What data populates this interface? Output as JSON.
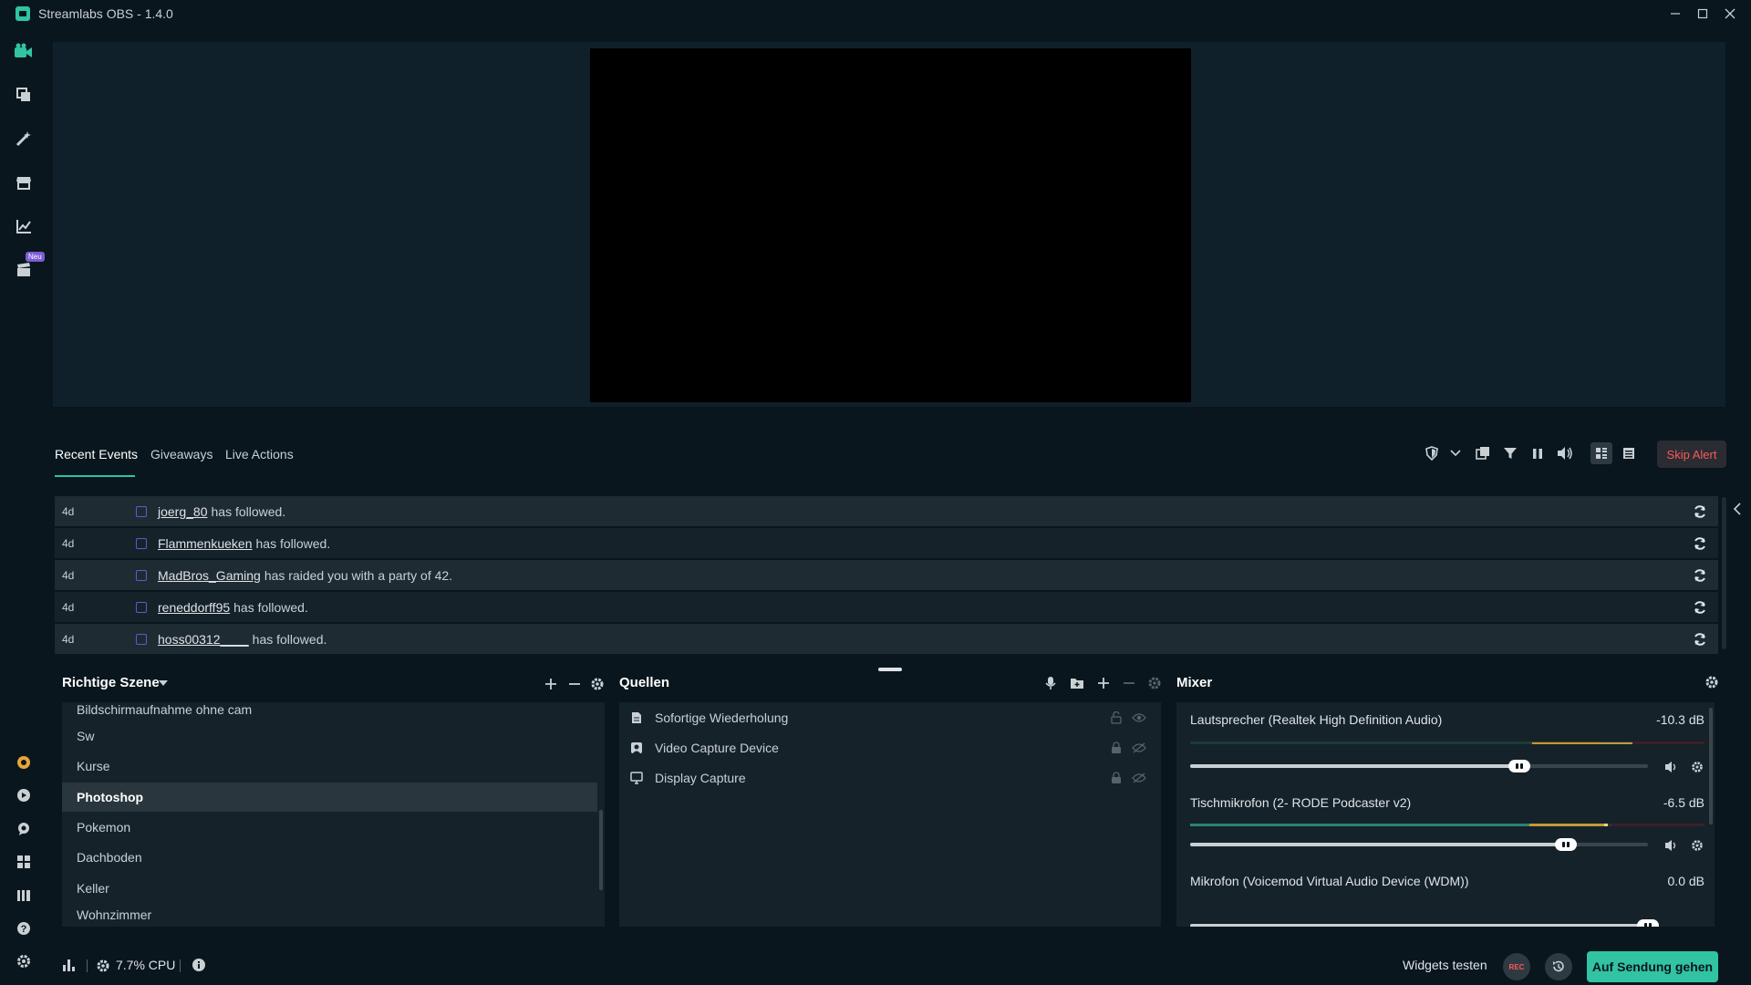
{
  "window": {
    "title": "Streamlabs OBS - 1.4.0"
  },
  "sidebar": {
    "new_badge": "Neu"
  },
  "events": {
    "tabs": [
      {
        "label": "Recent Events"
      },
      {
        "label": "Giveaways"
      },
      {
        "label": "Live Actions"
      }
    ],
    "skip_alert": "Skip Alert",
    "rows": [
      {
        "time": "4d",
        "user": "joerg_80",
        "message": "has followed."
      },
      {
        "time": "4d",
        "user": "Flammenkueken",
        "message": "has followed."
      },
      {
        "time": "4d",
        "user": "MadBros_Gaming",
        "message": "has raided you with a party of 42."
      },
      {
        "time": "4d",
        "user": "reneddorff95",
        "message": "has followed."
      },
      {
        "time": "4d",
        "user": "hoss00312____",
        "message": "has followed."
      }
    ]
  },
  "scenes": {
    "title": "Richtige Szene",
    "items": [
      {
        "label": "Bildschirmaufnahme ohne cam"
      },
      {
        "label": "Sw"
      },
      {
        "label": "Kurse"
      },
      {
        "label": "Photoshop"
      },
      {
        "label": "Pokemon"
      },
      {
        "label": "Dachboden"
      },
      {
        "label": "Keller"
      },
      {
        "label": "Wohnzimmer"
      }
    ]
  },
  "sources": {
    "title": "Quellen",
    "items": [
      {
        "label": "Sofortige Wiederholung"
      },
      {
        "label": "Video Capture Device"
      },
      {
        "label": "Display Capture"
      }
    ]
  },
  "mixer": {
    "title": "Mixer",
    "channels": [
      {
        "name": "Lautsprecher (Realtek High Definition Audio)",
        "db": "-10.3 dB",
        "volume": 0.72
      },
      {
        "name": "Tischmikrofon (2- RODE Podcaster v2)",
        "db": "-6.5 dB",
        "volume": 0.82
      },
      {
        "name": "Mikrofon (Voicemod Virtual Audio Device (WDM))",
        "db": "0.0 dB",
        "volume": 1.0
      }
    ]
  },
  "footer": {
    "cpu": "7.7% CPU",
    "widgets_test": "Widgets testen",
    "rec": "REC",
    "go_live": "Auf Sendung gehen"
  },
  "colors": {
    "accent": "#31c3a2",
    "background": "#09161d",
    "panel": "#15222a",
    "danger": "#f85a5a"
  }
}
